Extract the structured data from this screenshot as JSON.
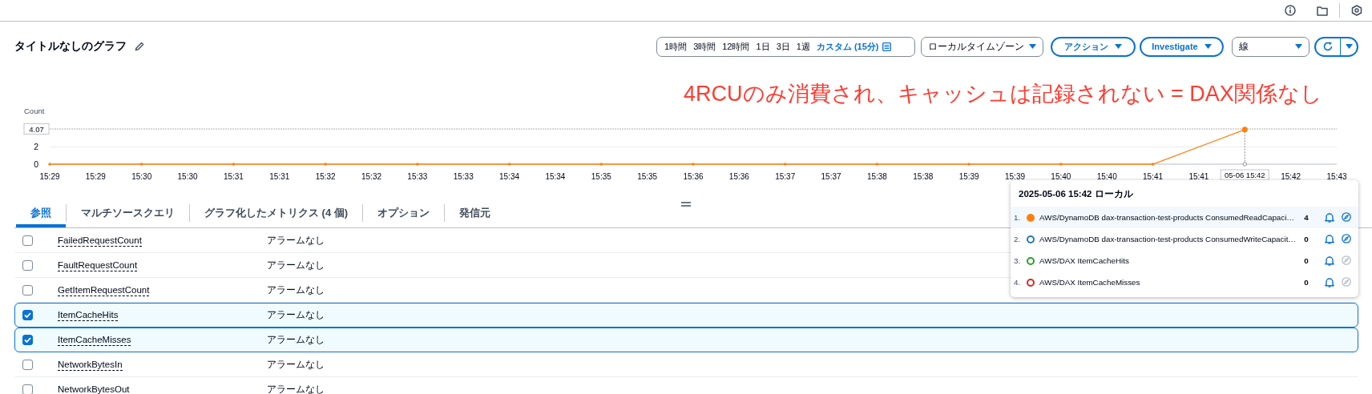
{
  "header": {
    "title": "タイトルなしのグラフ"
  },
  "toolbar": {
    "time_ranges": [
      {
        "label": "1時間",
        "selected": false
      },
      {
        "label": "3時間",
        "selected": false
      },
      {
        "label": "12時間",
        "selected": false
      },
      {
        "label": "1日",
        "selected": false
      },
      {
        "label": "3日",
        "selected": false
      },
      {
        "label": "1週",
        "selected": false
      },
      {
        "label": "カスタム (15分)",
        "selected": true
      }
    ],
    "timezone": "ローカルタイムゾーン",
    "actions_button": "アクション",
    "investigate_button": "Investigate",
    "chart_type": "線"
  },
  "annotation": "4RCUのみ消費され、キャッシュは記録されない = DAX関係なし",
  "chart": {
    "hover_label": "05-06 15:42",
    "chart_data": {
      "type": "line",
      "ylabel": "Count",
      "categories": [
        "15:29",
        "15:29",
        "15:30",
        "15:30",
        "15:31",
        "15:31",
        "15:32",
        "15:32",
        "15:33",
        "15:33",
        "15:34",
        "15:34",
        "15:35",
        "15:35",
        "15:36",
        "15:36",
        "15:37",
        "15:37",
        "15:38",
        "15:38",
        "15:39",
        "15:39",
        "15:40",
        "15:40",
        "15:41",
        "15:41",
        null,
        "15:42",
        "15:43"
      ],
      "ylim": [
        0,
        4.07
      ],
      "yticks": [
        0,
        2,
        {
          "value": 4.07,
          "label": "4.07"
        }
      ],
      "ref_lines": [
        {
          "axis": "y",
          "value": 2
        }
      ],
      "series": [
        {
          "color": "#ff7f0e",
          "values": [
            0,
            null,
            0,
            null,
            0,
            null,
            0,
            null,
            0,
            null,
            0,
            null,
            0,
            null,
            0,
            null,
            0,
            null,
            0,
            null,
            0,
            null,
            0,
            null,
            0,
            null,
            4,
            null,
            null
          ]
        }
      ]
    }
  },
  "tooltip": {
    "title": "2025-05-06 15:42 ローカル",
    "rows": [
      {
        "index": "1.",
        "name": "AWS/DynamoDB dax-transaction-test-products ConsumedReadCapaci…",
        "value": "4",
        "color": "#ff7f0e",
        "selected": true,
        "disabled": false
      },
      {
        "index": "2.",
        "name": "AWS/DynamoDB dax-transaction-test-products ConsumedWriteCapacit…",
        "value": "0",
        "color": "#1f77b4",
        "selected": false,
        "disabled": false
      },
      {
        "index": "3.",
        "name": "AWS/DAX ItemCacheHits",
        "value": "0",
        "color": "#2ca02c",
        "selected": false,
        "disabled": true
      },
      {
        "index": "4.",
        "name": "AWS/DAX ItemCacheMisses",
        "value": "0",
        "color": "#d62728",
        "selected": false,
        "disabled": true
      }
    ]
  },
  "tabs": [
    {
      "label": "参照",
      "selected": true
    },
    {
      "label": "マルチソースクエリ",
      "selected": false
    },
    {
      "label": "グラフ化したメトリクス (4 個)",
      "selected": false
    },
    {
      "label": "オプション",
      "selected": false
    },
    {
      "label": "発信元",
      "selected": false
    }
  ],
  "metrics": {
    "rows": [
      {
        "name": "FailedRequestCount",
        "alarm": "アラームなし",
        "checked": false
      },
      {
        "name": "FaultRequestCount",
        "alarm": "アラームなし",
        "checked": false
      },
      {
        "name": "GetItemRequestCount",
        "alarm": "アラームなし",
        "checked": false
      },
      {
        "name": "ItemCacheHits",
        "alarm": "アラームなし",
        "checked": true
      },
      {
        "name": "ItemCacheMisses",
        "alarm": "アラームなし",
        "checked": true
      },
      {
        "name": "NetworkBytesIn",
        "alarm": "アラームなし",
        "checked": false
      },
      {
        "name": "NetworkBytesOut",
        "alarm": "アラームなし",
        "checked": false
      }
    ]
  }
}
